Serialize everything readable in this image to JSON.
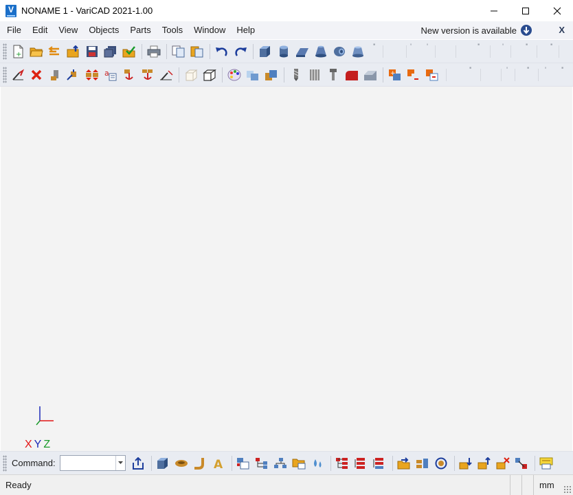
{
  "window": {
    "title": "NONAME 1 - VariCAD 2021-1.00",
    "logo_letter": "V",
    "controls": [
      "minimize",
      "maximize",
      "close"
    ]
  },
  "menu": {
    "items": [
      "File",
      "Edit",
      "View",
      "Objects",
      "Parts",
      "Tools",
      "Window",
      "Help"
    ],
    "update_notice": "New version is available",
    "close_label": "X"
  },
  "toolbar_row1": {
    "icons": [
      "new-file-icon",
      "open-folder-icon",
      "open-recent-icon",
      "import-folder-icon",
      "save-icon",
      "save-all-icon",
      "check-folder-icon",
      "print-icon",
      "copy-pages-icon",
      "paste-pages-icon",
      "undo-icon",
      "redo-icon",
      "box-solid-icon",
      "cylinder-solid-icon",
      "prism-solid-icon",
      "cone-solid-icon",
      "pipe-solid-icon",
      "frustum-solid-icon"
    ]
  },
  "toolbar_row2": {
    "icons": [
      "axes-transform-icon",
      "delete-red-x-icon",
      "move-object-icon",
      "copy-transform-icon",
      "mirror-icon",
      "text-label-icon",
      "anchor-red-icon",
      "anchor-group-icon",
      "axes-reset-icon",
      "wireframe-box-icon",
      "outline-box-icon",
      "color-palette-icon",
      "shaded-boxes-icon",
      "stacked-boxes-icon",
      "drill-bit-icon",
      "thread-icon",
      "bolt-icon",
      "fillet-red-icon",
      "chamfer-icon",
      "boolean-add-icon",
      "boolean-subtract-icon",
      "boolean-intersect-icon"
    ]
  },
  "canvas": {
    "background": "#f3f3f3",
    "axis_labels": {
      "x": "X",
      "y": "Y",
      "z": "Z"
    }
  },
  "command_bar": {
    "label": "Command:",
    "input_value": "",
    "icons": [
      "export-icon",
      "solid-box-icon",
      "rotate-solid-icon",
      "pipe-bend-icon",
      "text-solid-icon",
      "assembly-icon",
      "link-tree-icon",
      "hierarchy-icon",
      "folder-window-icon",
      "drop-icon",
      "bom-tree-red-icon",
      "bom-list-red-icon",
      "bom-list-blue-icon",
      "open-folder-blue-icon",
      "shelf-icon",
      "rotate-circle-icon",
      "insert-down-icon",
      "insert-up-icon",
      "delete-part-icon",
      "replace-part-icon",
      "properties-icon"
    ]
  },
  "status": {
    "text": "Ready",
    "unit": "mm"
  },
  "colors": {
    "accent_blue": "#1b6fc9",
    "axis_x": "#e21414",
    "axis_y": "#1c29b8",
    "axis_z": "#1a9a2a"
  }
}
